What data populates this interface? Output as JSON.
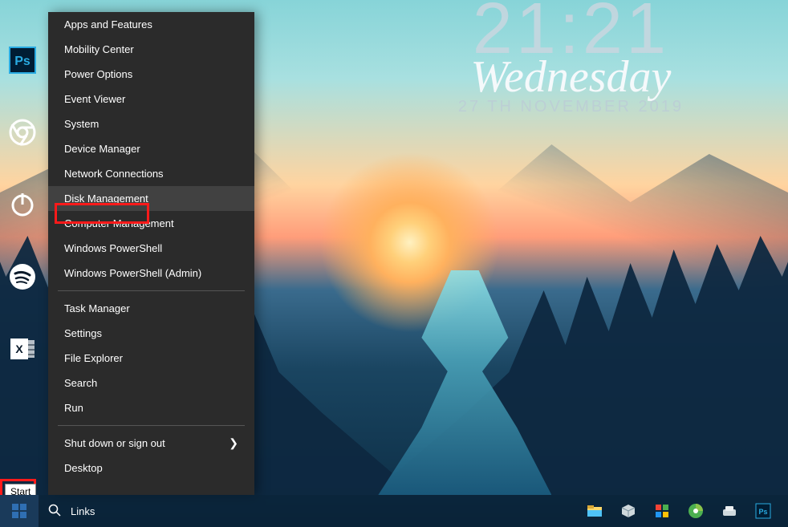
{
  "clock": {
    "time": "21:21",
    "day": "Wednesday",
    "date": "27 TH NOVEMBER 2019"
  },
  "desktop_icons": [
    {
      "name": "photoshop-icon"
    },
    {
      "name": "chrome-icon"
    },
    {
      "name": "power-icon"
    },
    {
      "name": "spotify-icon"
    },
    {
      "name": "excel-icon"
    }
  ],
  "winx_menu": {
    "group1": [
      "Apps and Features",
      "Mobility Center",
      "Power Options",
      "Event Viewer",
      "System",
      "Device Manager",
      "Network Connections",
      "Disk Management",
      "Computer Management",
      "Windows PowerShell",
      "Windows PowerShell (Admin)"
    ],
    "group2": [
      "Task Manager",
      "Settings",
      "File Explorer",
      "Search",
      "Run"
    ],
    "group3": [
      {
        "label": "Shut down or sign out",
        "submenu": true
      },
      {
        "label": "Desktop",
        "submenu": false
      }
    ],
    "hovered_index": 7
  },
  "start_tooltip": "Start",
  "taskbar": {
    "search_label": "Links",
    "tray": [
      {
        "name": "file-explorer-icon"
      },
      {
        "name": "cube-app-icon"
      },
      {
        "name": "defender-icon"
      },
      {
        "name": "disk-app-icon"
      },
      {
        "name": "device-app-icon"
      },
      {
        "name": "photoshop-tray-icon"
      }
    ]
  },
  "highlights": [
    "disk-management-item",
    "start-button"
  ]
}
